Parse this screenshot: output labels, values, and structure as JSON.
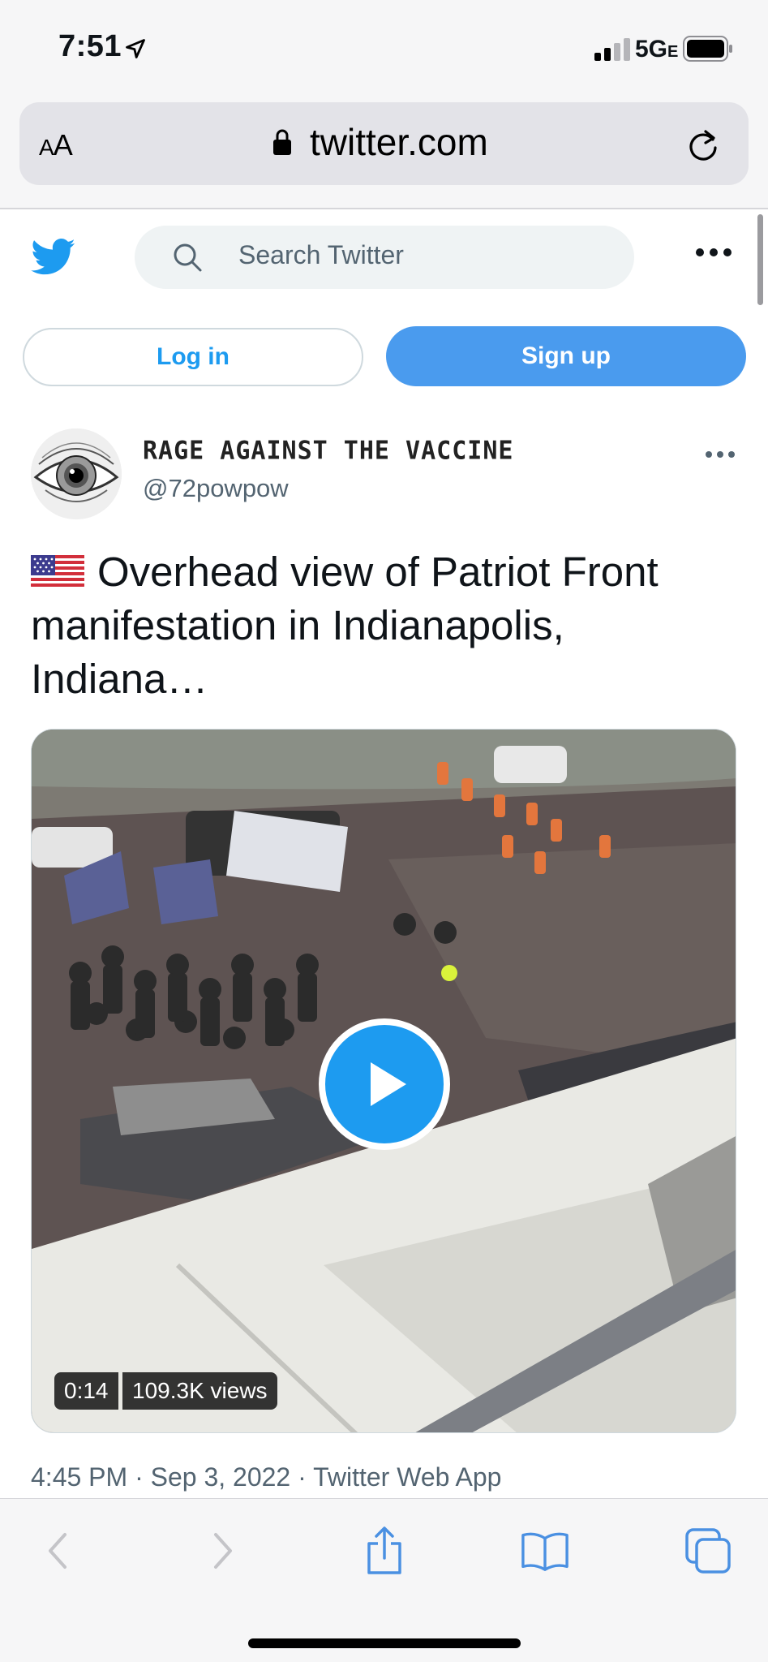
{
  "status_bar": {
    "time": "7:51",
    "network": "5G",
    "network_suffix": "E"
  },
  "address_bar": {
    "text_size_label_big": "A",
    "text_size_label_small": "A",
    "url": "twitter.com"
  },
  "header": {
    "search_placeholder": "Search Twitter"
  },
  "auth": {
    "login_label": "Log in",
    "signup_label": "Sign up"
  },
  "tweet": {
    "display_name": "RAGE AGAINST THE VACCINE",
    "handle": "@72powpow",
    "text": "Overhead view of Patriot Front manifestation in Indianapolis, Indiana…",
    "video_duration": "0:14",
    "video_views": "109.3K views",
    "meta": "4:45 PM · Sep 3, 2022 · Twitter Web App"
  },
  "colors": {
    "twitter_blue": "#1d9bf0",
    "signup_blue": "#4a9bee",
    "ios_blue": "#4a90e2",
    "muted_text": "#536471"
  },
  "icons": {
    "back": "chevron-left-icon",
    "forward": "chevron-right-icon",
    "share": "share-icon",
    "bookmarks": "book-icon",
    "tabs": "tabs-icon"
  }
}
